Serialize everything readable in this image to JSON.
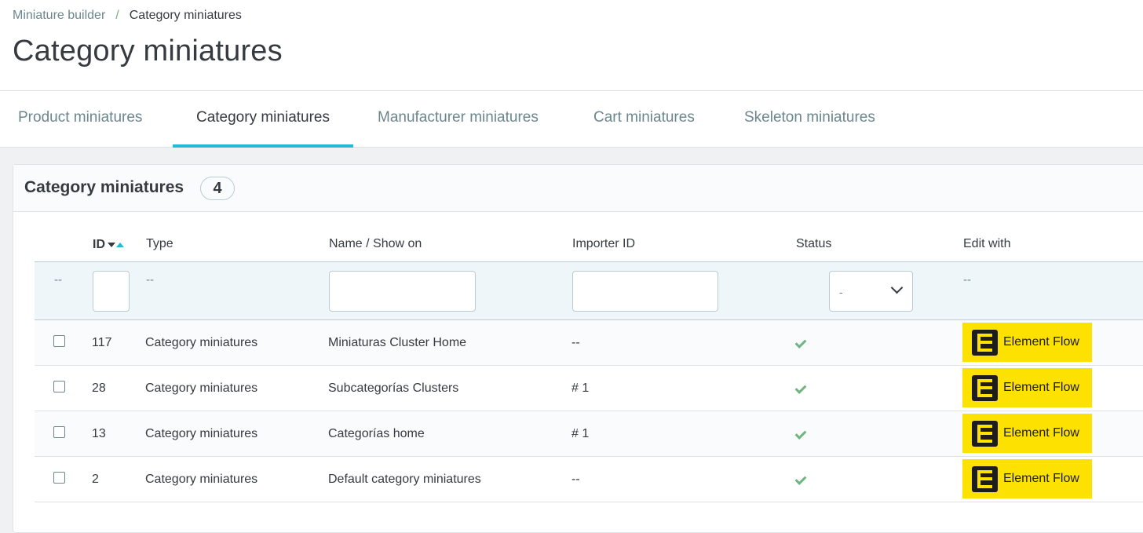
{
  "breadcrumb": {
    "parent": "Miniature builder",
    "separator": "/",
    "current": "Category miniatures"
  },
  "page_title": "Category miniatures",
  "tabs": [
    {
      "label": "Product miniatures",
      "active": false
    },
    {
      "label": "Category miniatures",
      "active": true
    },
    {
      "label": "Manufacturer miniatures",
      "active": false
    },
    {
      "label": "Cart miniatures",
      "active": false
    },
    {
      "label": "Skeleton miniatures",
      "active": false
    }
  ],
  "card": {
    "title": "Category miniatures",
    "count": "4"
  },
  "table": {
    "columns": [
      "ID",
      "Type",
      "Name / Show on",
      "Importer ID",
      "Status",
      "Edit with"
    ],
    "filters": {
      "bulk": "--",
      "type": "--",
      "status_value": "-",
      "edit_with": "--"
    },
    "rows": [
      {
        "id": "117",
        "type": "Category miniatures",
        "name": "Miniaturas Cluster Home",
        "importer_id": "--",
        "status": "enabled",
        "edit_with": "Element Flow"
      },
      {
        "id": "28",
        "type": "Category miniatures",
        "name": "Subcategorías Clusters",
        "importer_id": "# 1",
        "status": "enabled",
        "edit_with": "Element Flow"
      },
      {
        "id": "13",
        "type": "Category miniatures",
        "name": "Categorías home",
        "importer_id": "# 1",
        "status": "enabled",
        "edit_with": "Element Flow"
      },
      {
        "id": "2",
        "type": "Category miniatures",
        "name": "Default category miniatures",
        "importer_id": "--",
        "status": "enabled",
        "edit_with": "Element Flow"
      }
    ]
  },
  "colors": {
    "accent": "#25b9d7",
    "success": "#70b580",
    "element_flow": "#fde100"
  },
  "icons": {
    "sort": "sort-icon",
    "status": "check-icon",
    "element_flow": "element-flow-logo-icon",
    "select": "chevron-down-icon"
  }
}
